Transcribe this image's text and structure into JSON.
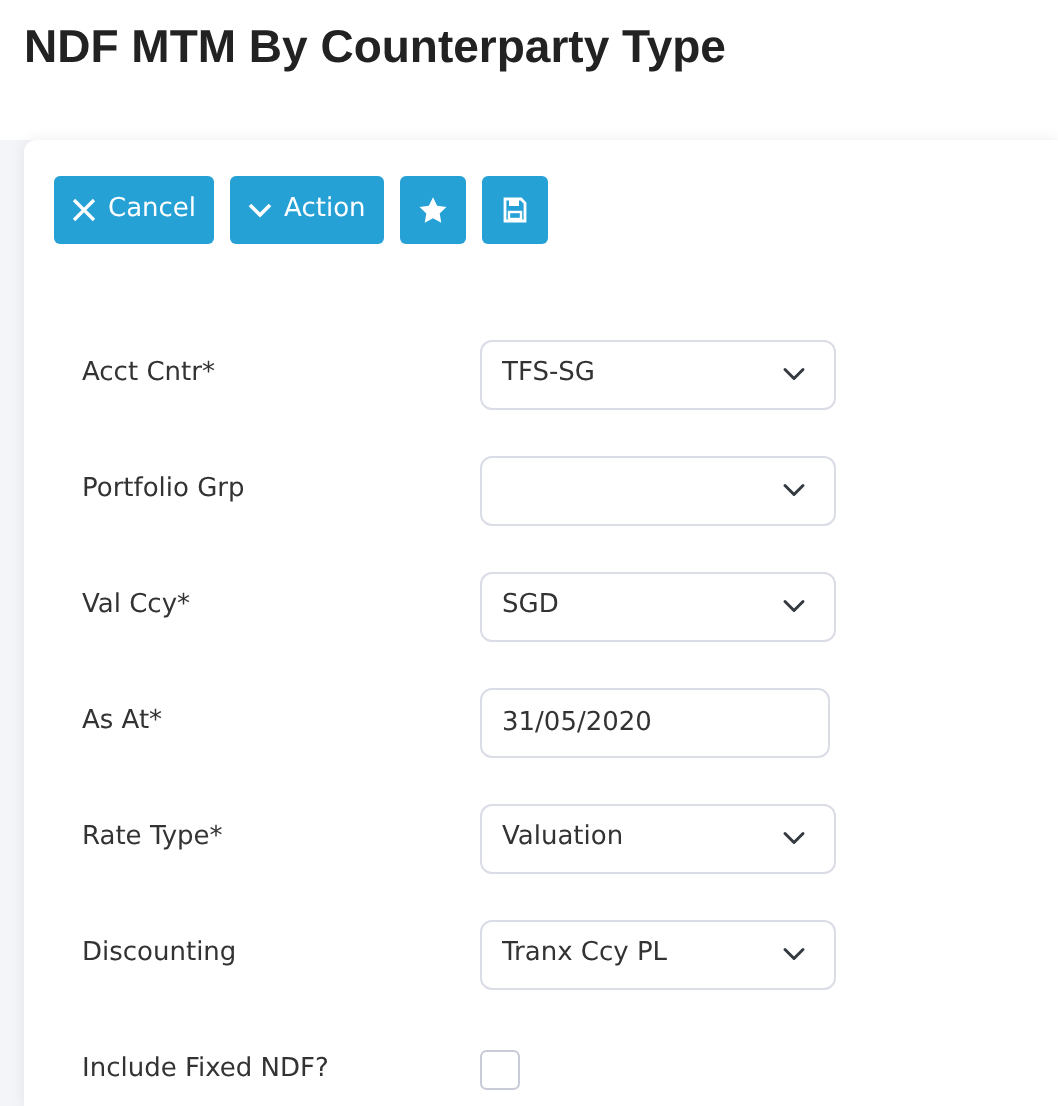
{
  "page_title": "NDF MTM By Counterparty Type",
  "toolbar": [
    {
      "kind": "cancel",
      "label": "Cancel"
    },
    {
      "kind": "action",
      "label": "Action"
    },
    {
      "kind": "favorite"
    },
    {
      "kind": "save"
    }
  ],
  "fields": [
    {
      "kind": "select",
      "label": "Acct Cntr*",
      "value": "TFS-SG"
    },
    {
      "kind": "select",
      "label": "Portfolio Grp"
    },
    {
      "kind": "select",
      "label": "Val Ccy*",
      "value": "SGD"
    },
    {
      "kind": "date",
      "label": "As At*",
      "value": "31/05/2020"
    },
    {
      "kind": "select",
      "label": "Rate Type*",
      "value": "Valuation"
    },
    {
      "kind": "select",
      "label": "Discounting",
      "value": "Tranx Ccy PL"
    },
    {
      "kind": "checkbox",
      "label": "Include Fixed NDF?",
      "checked": false
    }
  ]
}
